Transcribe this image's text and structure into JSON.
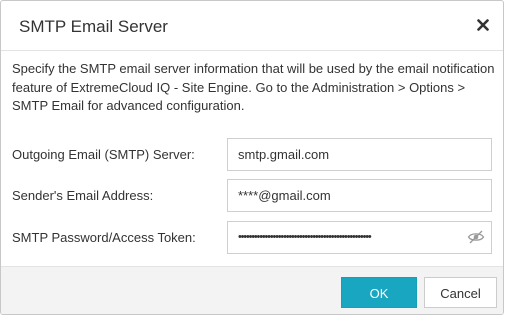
{
  "dialog": {
    "title": "SMTP Email Server",
    "close_icon": "close-x-icon",
    "description": "Specify the SMTP email server information that will be used by the email notification feature of ExtremeCloud IQ - Site Engine. Go to the Administration > Options > SMTP Email for advanced configuration."
  },
  "form": {
    "server": {
      "label": "Outgoing Email (SMTP) Server:",
      "value": "smtp.gmail.com"
    },
    "sender": {
      "label": "Sender's Email Address:",
      "value": "****@gmail.com"
    },
    "password": {
      "label": "SMTP Password/Access Token:",
      "value": "••••••••••••••••••••••••••••••••••••••••••••••••••",
      "toggle_icon": "eye-slash-icon"
    }
  },
  "footer": {
    "ok_label": "OK",
    "cancel_label": "Cancel"
  },
  "colors": {
    "primary_button": "#18a6c0",
    "footer_bg": "#f3f3f3"
  }
}
